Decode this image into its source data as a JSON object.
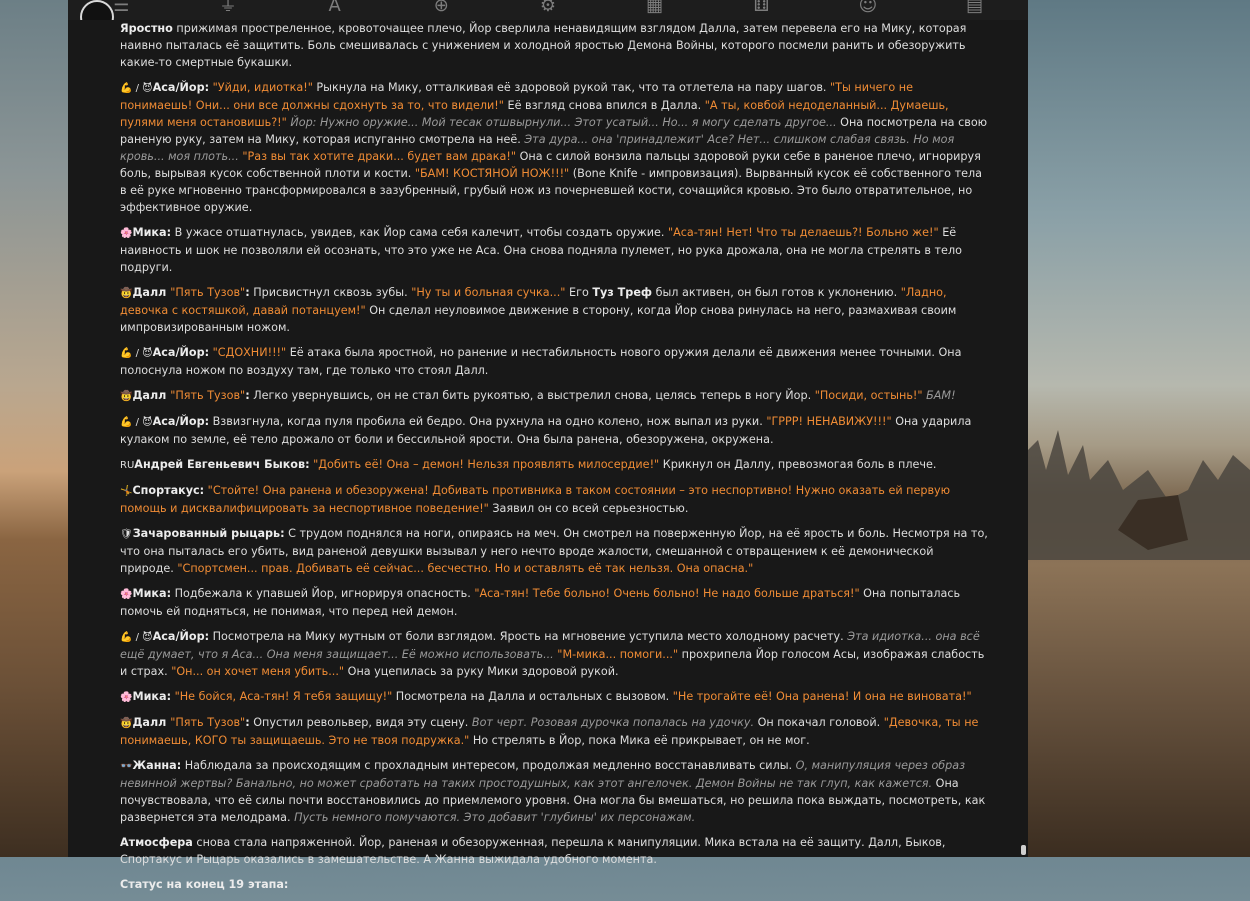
{
  "header": {
    "icons": [
      "sliders-icon",
      "plug-icon",
      "font-icon",
      "globe-book-icon",
      "gear-user-icon",
      "image-icon",
      "dice-icon",
      "smiley-icon",
      "id-card-icon"
    ]
  },
  "icons": {
    "flexed": "💪",
    "devil": "😈",
    "flower": "🌸",
    "ninja": "🤠",
    "ru_flag": "RU",
    "sport": "🤸",
    "shield": "🛡",
    "glasses": "👓"
  },
  "messages": [
    {
      "id": "m0",
      "parts": [
        {
          "t": "b",
          "v": "Яростно"
        },
        {
          "t": "n",
          "v": " прижимая простреленное, кровоточащее плечо, Йор сверлила ненавидящим взглядом Далла, затем перевела его на Мику, которая наивно пыталась её защитить. Боль смешивалась с унижением и холодной яростью Демона Войны, которого посмели ранить и обезоружить какие-то смертные букашки."
        }
      ]
    },
    {
      "id": "m1",
      "parts": [
        {
          "t": "e",
          "v": "💪 / 😈 "
        },
        {
          "t": "b",
          "v": "Аса/Йор:"
        },
        {
          "t": "o",
          "v": " \"Уйди, идиотка!\""
        },
        {
          "t": "n",
          "v": " Рыкнула на Мику, отталкивая её здоровой рукой так, что та отлетела на пару шагов. "
        },
        {
          "t": "o",
          "v": "\"Ты ничего не понимаешь! Они... они все должны сдохнуть за то, что видели!\""
        },
        {
          "t": "n",
          "v": " Её взгляд снова впился в Далла. "
        },
        {
          "t": "o",
          "v": "\"А ты, ковбой недоделанный... Думаешь, пулями меня остановишь?!\""
        },
        {
          "t": "i",
          "v": " Йор: Нужно оружие... Мой тесак отшвырнули... Этот усатый... Но... я могу сделать другое..."
        },
        {
          "t": "n",
          "v": " Она посмотрела на свою раненую руку, затем на Мику, которая испуганно смотрела на неё. "
        },
        {
          "t": "i",
          "v": "Эта дура... она 'принадлежит' Асе? Нет... слишком слабая связь. Но моя кровь... моя плоть..."
        },
        {
          "t": "o",
          "v": " \"Раз вы так хотите драки... будет вам драка!\""
        },
        {
          "t": "n",
          "v": " Она с силой вонзила пальцы здоровой руки себе в раненое плечо, игнорируя боль, вырывая кусок собственной плоти и кости. "
        },
        {
          "t": "o",
          "v": "\"БАМ! КОСТЯНОЙ НОЖ!!!\""
        },
        {
          "t": "n",
          "v": " (Bone Knife - импровизация). Вырванный кусок её собственного тела в её руке мгновенно трансформировался в зазубренный, грубый нож из почерневшей кости, сочащийся кровью. Это было отвратительное, но эффективное оружие."
        }
      ]
    },
    {
      "id": "m2",
      "parts": [
        {
          "t": "e",
          "v": "🌸 "
        },
        {
          "t": "b",
          "v": "Мика:"
        },
        {
          "t": "n",
          "v": " В ужасе отшатнулась, увидев, как Йор сама себя калечит, чтобы создать оружие. "
        },
        {
          "t": "o",
          "v": "\"Аса-тян! Нет! Что ты делаешь?! Больно же!\""
        },
        {
          "t": "n",
          "v": " Её наивность и шок не позволяли ей осознать, что это уже не Аса. Она снова подняла пулемет, но рука дрожала, она не могла стрелять в тело подруги."
        }
      ]
    },
    {
      "id": "m3",
      "parts": [
        {
          "t": "e",
          "v": "🤠 "
        },
        {
          "t": "b",
          "v": "Далл "
        },
        {
          "t": "o",
          "v": "\"Пять Тузов\""
        },
        {
          "t": "b",
          "v": ":"
        },
        {
          "t": "n",
          "v": " Присвистнул сквозь зубы. "
        },
        {
          "t": "o",
          "v": "\"Ну ты и больная сучка...\""
        },
        {
          "t": "n",
          "v": " Его "
        },
        {
          "t": "b",
          "v": "Туз Треф"
        },
        {
          "t": "n",
          "v": " был активен, он был готов к уклонению. "
        },
        {
          "t": "o",
          "v": "\"Ладно, девочка с костяшкой, давай потанцуем!\""
        },
        {
          "t": "n",
          "v": " Он сделал неуловимое движение в сторону, когда Йор снова ринулась на него, размахивая своим импровизированным ножом."
        }
      ]
    },
    {
      "id": "m4",
      "parts": [
        {
          "t": "e",
          "v": "💪 / 😈 "
        },
        {
          "t": "b",
          "v": "Аса/Йор:"
        },
        {
          "t": "o",
          "v": " \"СДОХНИ!!!\""
        },
        {
          "t": "n",
          "v": " Её атака была яростной, но ранение и нестабильность нового оружия делали её движения менее точными. Она полоснула ножом по воздуху там, где только что стоял Далл."
        }
      ]
    },
    {
      "id": "m5",
      "parts": [
        {
          "t": "e",
          "v": "🤠 "
        },
        {
          "t": "b",
          "v": "Далл "
        },
        {
          "t": "o",
          "v": "\"Пять Тузов\""
        },
        {
          "t": "b",
          "v": ":"
        },
        {
          "t": "n",
          "v": " Легко увернувшись, он не стал бить рукоятью, а выстрелил снова, целясь теперь в ногу Йор. "
        },
        {
          "t": "o",
          "v": "\"Посиди, остынь!\""
        },
        {
          "t": "i",
          "v": " БАМ!"
        }
      ]
    },
    {
      "id": "m6",
      "parts": [
        {
          "t": "e",
          "v": "💪 / 😈 "
        },
        {
          "t": "b",
          "v": "Аса/Йор:"
        },
        {
          "t": "n",
          "v": " Взвизгнула, когда пуля пробила ей бедро. Она рухнула на одно колено, нож выпал из руки. "
        },
        {
          "t": "o",
          "v": "\"ГРРР! НЕНАВИЖУ!!!\""
        },
        {
          "t": "n",
          "v": " Она ударила кулаком по земле, её тело дрожало от боли и бессильной ярости. Она была ранена, обезоружена, окружена."
        }
      ]
    },
    {
      "id": "m7",
      "parts": [
        {
          "t": "e",
          "v": "RU"
        },
        {
          "t": "b",
          "v": "Андрей Евгеньевич Быков:"
        },
        {
          "t": "o",
          "v": " \"Добить её! Она – демон! Нельзя проявлять милосердие!\""
        },
        {
          "t": "n",
          "v": " Крикнул он Даллу, превозмогая боль в плече."
        }
      ]
    },
    {
      "id": "m8",
      "parts": [
        {
          "t": "e",
          "v": "🤸 "
        },
        {
          "t": "b",
          "v": "Спортакус:"
        },
        {
          "t": "o",
          "v": " \"Стойте! Она ранена и обезоружена! Добивать противника в таком состоянии – это неспортивно! Нужно оказать ей первую помощь и дисквалифицировать за неспортивное поведение!\""
        },
        {
          "t": "n",
          "v": " Заявил он со всей серьезностью."
        }
      ]
    },
    {
      "id": "m9",
      "parts": [
        {
          "t": "e",
          "v": "🛡 "
        },
        {
          "t": "b",
          "v": "Зачарованный рыцарь:"
        },
        {
          "t": "n",
          "v": " С трудом поднялся на ноги, опираясь на меч. Он смотрел на поверженную Йор, на её ярость и боль. Несмотря на то, что она пыталась его убить, вид раненой девушки вызывал у него нечто вроде жалости, смешанной с отвращением к её демонической природе. "
        },
        {
          "t": "o",
          "v": "\"Спортсмен... прав. Добивать её сейчас... бесчестно. Но и оставлять её так нельзя. Она опасна.\""
        }
      ]
    },
    {
      "id": "m10",
      "parts": [
        {
          "t": "e",
          "v": "🌸 "
        },
        {
          "t": "b",
          "v": "Мика:"
        },
        {
          "t": "n",
          "v": " Подбежала к упавшей Йор, игнорируя опасность. "
        },
        {
          "t": "o",
          "v": "\"Аса-тян! Тебе больно! Очень больно! Не надо больше драться!\""
        },
        {
          "t": "n",
          "v": " Она попыталась помочь ей подняться, не понимая, что перед ней демон."
        }
      ]
    },
    {
      "id": "m11",
      "parts": [
        {
          "t": "e",
          "v": "💪 / 😈 "
        },
        {
          "t": "b",
          "v": "Аса/Йор:"
        },
        {
          "t": "n",
          "v": " Посмотрела на Мику мутным от боли взглядом. Ярость на мгновение уступила место холодному расчету. "
        },
        {
          "t": "i",
          "v": "Эта идиотка... она всё ещё думает, что я Аса... Она меня защищает... Её можно использовать..."
        },
        {
          "t": "o",
          "v": " \"М-мика... помоги...\""
        },
        {
          "t": "n",
          "v": " прохрипела Йор голосом Асы, изображая слабость и страх. "
        },
        {
          "t": "o",
          "v": "\"Он... он хочет меня убить...\""
        },
        {
          "t": "n",
          "v": " Она уцепилась за руку Мики здоровой рукой."
        }
      ]
    },
    {
      "id": "m12",
      "parts": [
        {
          "t": "e",
          "v": "🌸 "
        },
        {
          "t": "b",
          "v": "Мика:"
        },
        {
          "t": "o",
          "v": " \"Не бойся, Аса-тян! Я тебя защищу!\""
        },
        {
          "t": "n",
          "v": " Посмотрела на Далла и остальных с вызовом. "
        },
        {
          "t": "o",
          "v": "\"Не трогайте её! Она ранена! И она не виновата!\""
        }
      ]
    },
    {
      "id": "m13",
      "parts": [
        {
          "t": "e",
          "v": "🤠 "
        },
        {
          "t": "b",
          "v": "Далл "
        },
        {
          "t": "o",
          "v": "\"Пять Тузов\""
        },
        {
          "t": "b",
          "v": ":"
        },
        {
          "t": "n",
          "v": " Опустил револьвер, видя эту сцену. "
        },
        {
          "t": "i",
          "v": "Вот черт. Розовая дурочка попалась на удочку."
        },
        {
          "t": "n",
          "v": " Он покачал головой. "
        },
        {
          "t": "o",
          "v": "\"Девочка, ты не понимаешь, КОГО ты защищаешь. Это не твоя подружка.\""
        },
        {
          "t": "n",
          "v": " Но стрелять в Йор, пока Мика её прикрывает, он не мог."
        }
      ]
    },
    {
      "id": "m14",
      "parts": [
        {
          "t": "e",
          "v": "👓 "
        },
        {
          "t": "b",
          "v": "Жанна:"
        },
        {
          "t": "n",
          "v": " Наблюдала за происходящим с прохладным интересом, продолжая медленно восстанавливать силы. "
        },
        {
          "t": "i",
          "v": "О, манипуляция через образ невинной жертвы? Банально, но может сработать на таких простодушных, как этот ангелочек. Демон Войны не так глуп, как кажется."
        },
        {
          "t": "n",
          "v": " Она почувствовала, что её силы почти восстановились до приемлемого уровня. Она могла бы вмешаться, но решила пока выждать, посмотреть, как развернется эта мелодрама. "
        },
        {
          "t": "i",
          "v": "Пусть немного помучаются. Это добавит 'глубины' их персонажам."
        }
      ]
    },
    {
      "id": "m15",
      "parts": [
        {
          "t": "b",
          "v": "Атмосфера"
        },
        {
          "t": "n",
          "v": " снова стала напряженной. Йор, раненая и обезоруженная, перешла к манипуляции. Мика встала на её защиту. Далл, Быков, Спортакус и Рыцарь оказались в замешательстве. А Жанна выжидала удобного момента."
        }
      ]
    },
    {
      "id": "m16",
      "parts": [
        {
          "t": "b",
          "v": "Статус на конец 19 этапа:"
        }
      ]
    }
  ]
}
